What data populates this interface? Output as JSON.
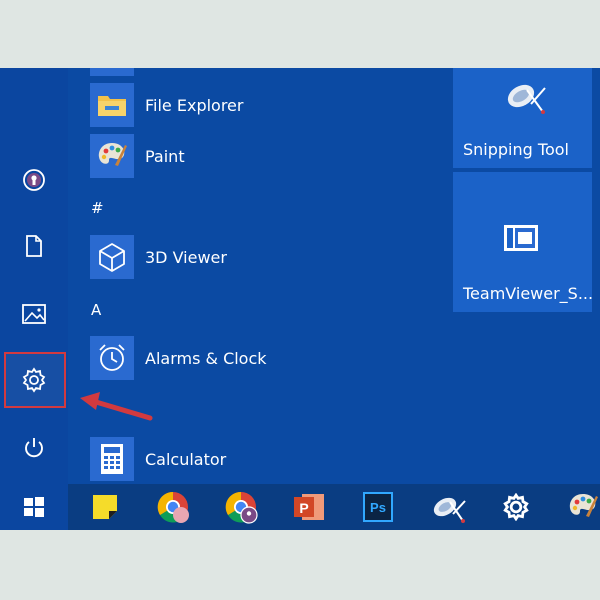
{
  "start_menu": {
    "apps": [
      {
        "label": "File Explorer",
        "icon": "folder-icon"
      },
      {
        "label": "Paint",
        "icon": "paint-palette-icon"
      },
      {
        "label": "3D Viewer",
        "icon": "cube-icon"
      },
      {
        "label": "Alarms & Clock",
        "icon": "alarm-clock-icon"
      },
      {
        "label": "Calculator",
        "icon": "calculator-icon"
      }
    ],
    "section_headers": [
      "#",
      "A"
    ]
  },
  "left_rail": {
    "items": [
      "user-account-icon",
      "documents-icon",
      "pictures-icon",
      "settings-gear-icon",
      "power-icon"
    ],
    "highlight_color": "#d23a3f"
  },
  "live_tiles": [
    {
      "label": "Snipping Tool",
      "icon": "snipping-tool-icon"
    },
    {
      "label": "TeamViewer_S...",
      "icon": "app-window-icon"
    }
  ],
  "taskbar": {
    "items": [
      "windows-start-icon",
      "sticky-notes-icon",
      "chrome-icon",
      "chrome-profile-icon",
      "powerpoint-icon",
      "photoshop-icon",
      "snipping-tool-icon",
      "settings-gear-icon",
      "paint-icon"
    ],
    "photoshop_label": "Ps",
    "powerpoint_label": "P"
  },
  "colors": {
    "start_bg": "#0b4aa3",
    "tile_bg": "#1b62c8",
    "app_tile_bg": "#2a6ad0",
    "taskbar_bg": "#0a3d82",
    "arrow": "#d23a3f"
  }
}
